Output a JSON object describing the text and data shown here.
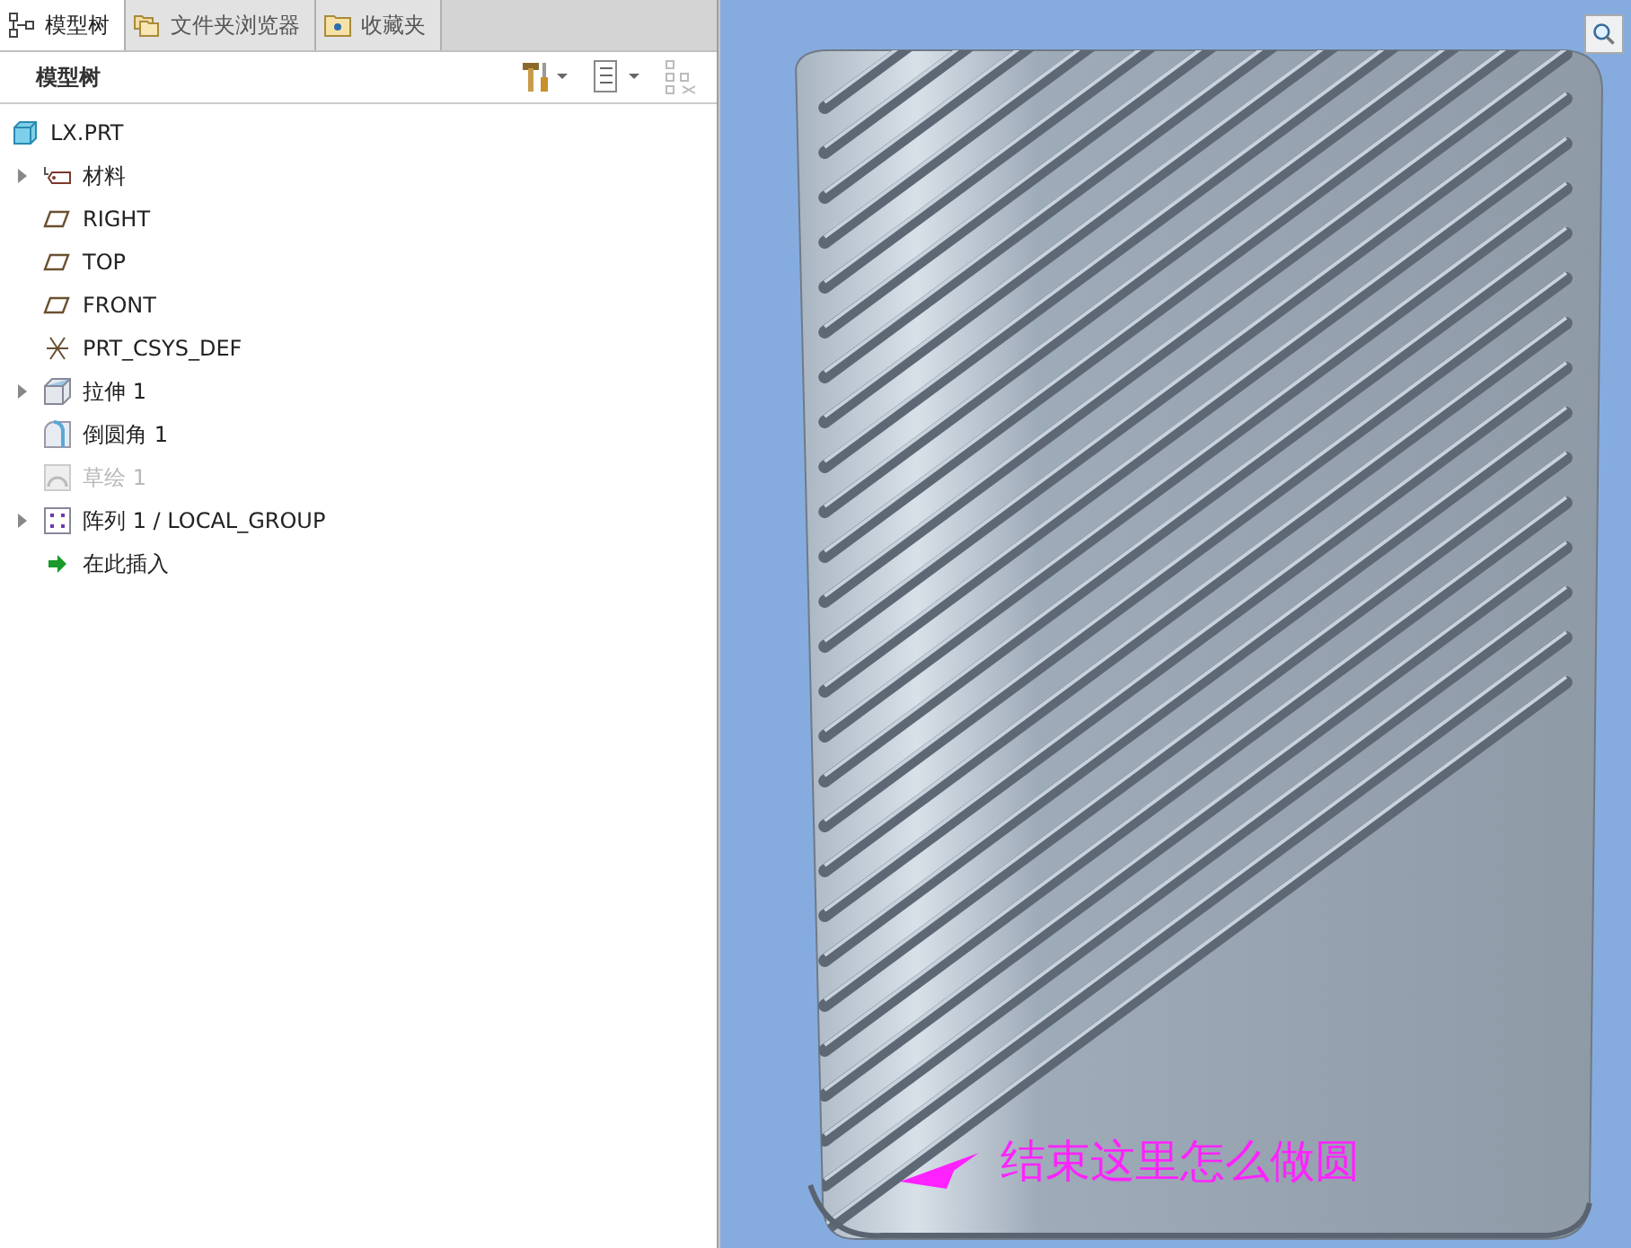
{
  "tabs": [
    {
      "label": "模型树",
      "kind": "tree",
      "selected": true
    },
    {
      "label": "文件夹浏览器",
      "kind": "folders",
      "selected": false
    },
    {
      "label": "收藏夹",
      "kind": "favorites",
      "selected": false
    }
  ],
  "toolbar": {
    "title": "模型树"
  },
  "tree": {
    "label": "LX.PRT",
    "kind": "part",
    "children": [
      {
        "label": "材料",
        "kind": "material",
        "expanded": false,
        "disabled": false
      },
      {
        "label": "RIGHT",
        "kind": "plane",
        "disabled": false
      },
      {
        "label": "TOP",
        "kind": "plane",
        "disabled": false
      },
      {
        "label": "FRONT",
        "kind": "plane",
        "disabled": false
      },
      {
        "label": "PRT_CSYS_DEF",
        "kind": "csys",
        "disabled": false
      },
      {
        "label": "拉伸 1",
        "kind": "extrude",
        "expanded": false,
        "disabled": false
      },
      {
        "label": "倒圆角 1",
        "kind": "round",
        "disabled": false
      },
      {
        "label": "草绘 1",
        "kind": "sketch",
        "disabled": true
      },
      {
        "label": "阵列 1 / LOCAL_GROUP",
        "kind": "pattern",
        "expanded": false,
        "disabled": false
      },
      {
        "label": "在此插入",
        "kind": "insert",
        "disabled": false
      }
    ]
  },
  "viewport": {
    "annotation": "结束这里怎么做圆"
  }
}
